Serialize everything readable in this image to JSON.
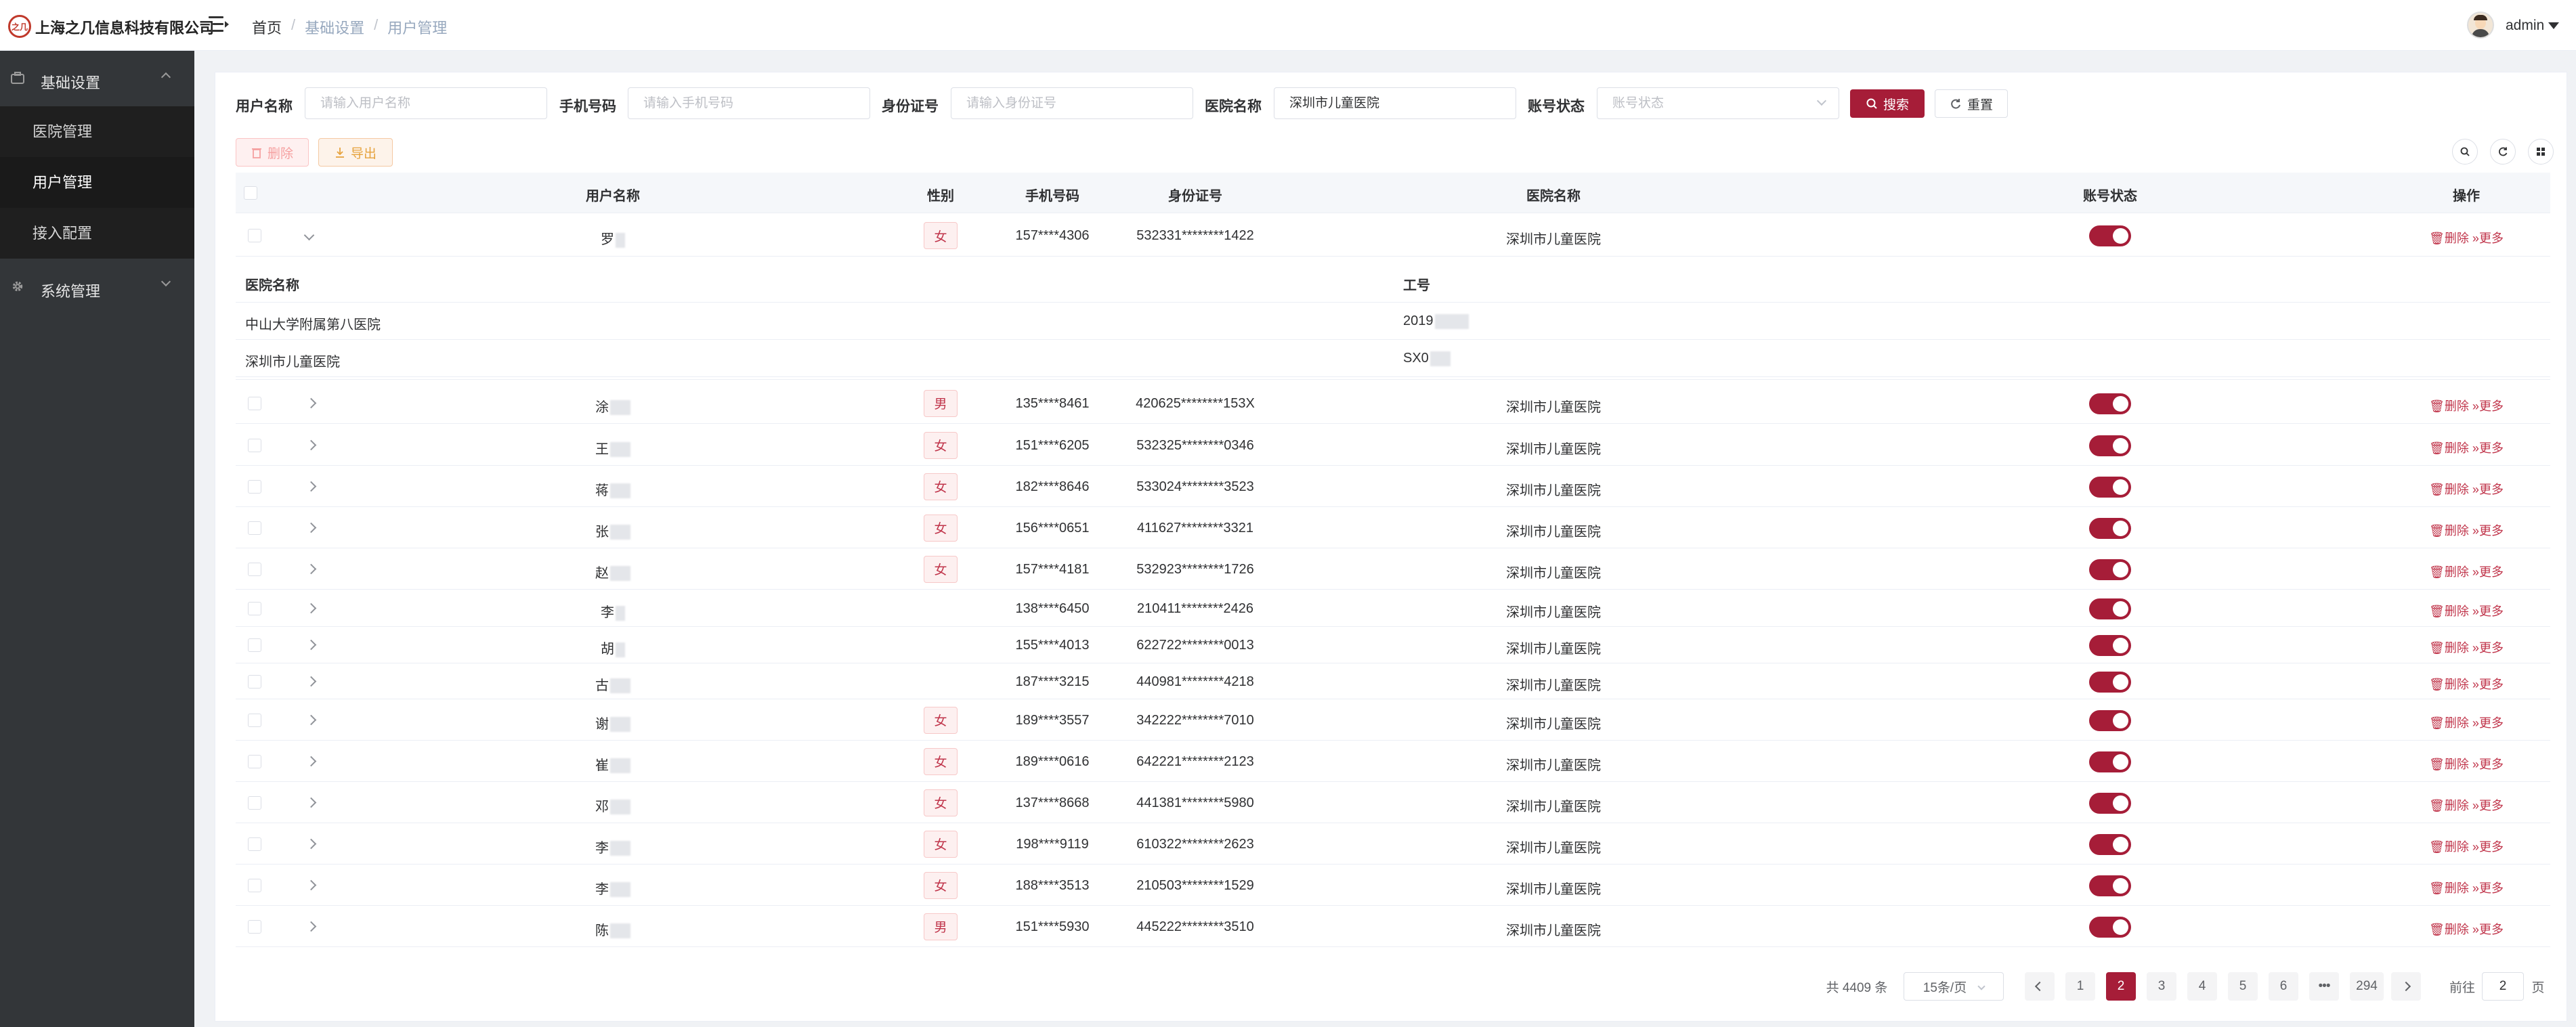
{
  "header": {
    "logo_text": "之几",
    "company": "上海之几信息科技有限公司",
    "breadcrumb": [
      "首页",
      "基础设置",
      "用户管理"
    ],
    "username": "admin"
  },
  "sidebar": {
    "group1": {
      "label": "基础设置",
      "items": [
        "医院管理",
        "用户管理",
        "接入配置"
      ],
      "active": "用户管理"
    },
    "group2": {
      "label": "系统管理"
    }
  },
  "filters": {
    "username_label": "用户名称",
    "username_placeholder": "请输入用户名称",
    "phone_label": "手机号码",
    "phone_placeholder": "请输入手机号码",
    "idcard_label": "身份证号",
    "idcard_placeholder": "请输入身份证号",
    "hospital_label": "医院名称",
    "hospital_value": "深圳市儿童医院",
    "status_label": "账号状态",
    "status_placeholder": "账号状态",
    "search_label": "搜索",
    "reset_label": "重置"
  },
  "actions": {
    "delete_label": "删除",
    "export_label": "导出"
  },
  "table": {
    "columns": [
      "用户名称",
      "性别",
      "手机号码",
      "身份证号",
      "医院名称",
      "账号状态",
      "操作"
    ],
    "ops": {
      "delete": "删除",
      "more": "更多"
    },
    "expanded": {
      "headers": [
        "医院名称",
        "工号"
      ],
      "rows": [
        [
          "中山大学附属第八医院",
          "2019"
        ],
        [
          "深圳市儿童医院",
          "SX0"
        ]
      ]
    },
    "rows": [
      {
        "name": "罗",
        "gender": "女",
        "phone": "157****4306",
        "idcard": "532331********1422",
        "hospital": "深圳市儿童医院"
      },
      {
        "name": "涂",
        "gender": "男",
        "phone": "135****8461",
        "idcard": "420625********153X",
        "hospital": "深圳市儿童医院"
      },
      {
        "name": "王",
        "gender": "女",
        "phone": "151****6205",
        "idcard": "532325********0346",
        "hospital": "深圳市儿童医院"
      },
      {
        "name": "蒋",
        "gender": "女",
        "phone": "182****8646",
        "idcard": "533024********3523",
        "hospital": "深圳市儿童医院"
      },
      {
        "name": "张",
        "gender": "女",
        "phone": "156****0651",
        "idcard": "411627********3321",
        "hospital": "深圳市儿童医院"
      },
      {
        "name": "赵",
        "gender": "女",
        "phone": "157****4181",
        "idcard": "532923********1726",
        "hospital": "深圳市儿童医院"
      },
      {
        "name": "李",
        "gender": "",
        "phone": "138****6450",
        "idcard": "210411********2426",
        "hospital": "深圳市儿童医院"
      },
      {
        "name": "胡",
        "gender": "",
        "phone": "155****4013",
        "idcard": "622722********0013",
        "hospital": "深圳市儿童医院"
      },
      {
        "name": "古",
        "gender": "",
        "phone": "187****3215",
        "idcard": "440981********4218",
        "hospital": "深圳市儿童医院"
      },
      {
        "name": "谢",
        "gender": "女",
        "phone": "189****3557",
        "idcard": "342222********7010",
        "hospital": "深圳市儿童医院"
      },
      {
        "name": "崔",
        "gender": "女",
        "phone": "189****0616",
        "idcard": "642221********2123",
        "hospital": "深圳市儿童医院"
      },
      {
        "name": "邓",
        "gender": "女",
        "phone": "137****8668",
        "idcard": "441381********5980",
        "hospital": "深圳市儿童医院"
      },
      {
        "name": "李",
        "gender": "女",
        "phone": "198****9119",
        "idcard": "610322********2623",
        "hospital": "深圳市儿童医院"
      },
      {
        "name": "李",
        "gender": "女",
        "phone": "188****3513",
        "idcard": "210503********1529",
        "hospital": "深圳市儿童医院"
      },
      {
        "name": "陈",
        "gender": "男",
        "phone": "151****5930",
        "idcard": "445222********3510",
        "hospital": "深圳市儿童医院"
      }
    ]
  },
  "pagination": {
    "total": "共 4409 条",
    "page_size": "15条/页",
    "pages": [
      "1",
      "2",
      "3",
      "4",
      "5",
      "6",
      "294"
    ],
    "current": "2",
    "ellipsis": "•••",
    "goto_label": "前往",
    "goto_value": "2",
    "page_suffix": "页"
  }
}
